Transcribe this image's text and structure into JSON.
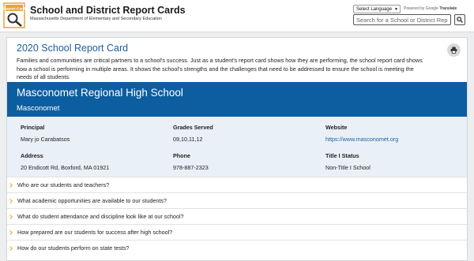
{
  "header": {
    "title": "School and District Report Cards",
    "subtitle": "Massachusetts Department of Elementary and Secondary Education",
    "logo_text": "Report Card",
    "language_select": "Select Language",
    "powered_by": "Powered by",
    "google": "Google",
    "translate": "Translate",
    "search_placeholder": "Search for a School or District Report Card"
  },
  "report_card": {
    "title": "2020 School Report Card",
    "description": "Families and communities are critical partners to a school's success. Just as a student's report card shows how they are performing, the school report card shows how a school is performing in multiple areas. It shows the school's strengths and the challenges that need to be addressed to ensure the school is meeting the needs of all students."
  },
  "school": {
    "name": "Masconomet Regional High School",
    "district": "Masconomet"
  },
  "info": {
    "principal_label": "Principal",
    "principal": "Mary jo Carabatsos",
    "grades_label": "Grades Served",
    "grades": "09,10,11,12",
    "website_label": "Website",
    "website": "https://www.masconomet.org",
    "address_label": "Address",
    "address": "20 Endicott Rd, Boxford, MA 01921",
    "phone_label": "Phone",
    "phone": "978-887-2323",
    "title1_label": "Title I Status",
    "title1": "Non-Title I School"
  },
  "accordion": [
    "Who are our students and teachers?",
    "What academic opportunities are available to our students?",
    "What do student attendance and discipline look like at our school?",
    "How prepared are our students for success after high school?",
    "How do our students perform on state tests?"
  ],
  "colors": {
    "brand_blue": "#0d5ea0",
    "title_blue": "#1d5e9b",
    "accent_orange": "#e8a33b",
    "panel_bg": "#e9f0f8"
  },
  "icons": {
    "logo": "report-card-magnifier-icon",
    "print": "printer-icon",
    "search": "magnifier-icon",
    "accordion": "chevron-right-icon"
  }
}
